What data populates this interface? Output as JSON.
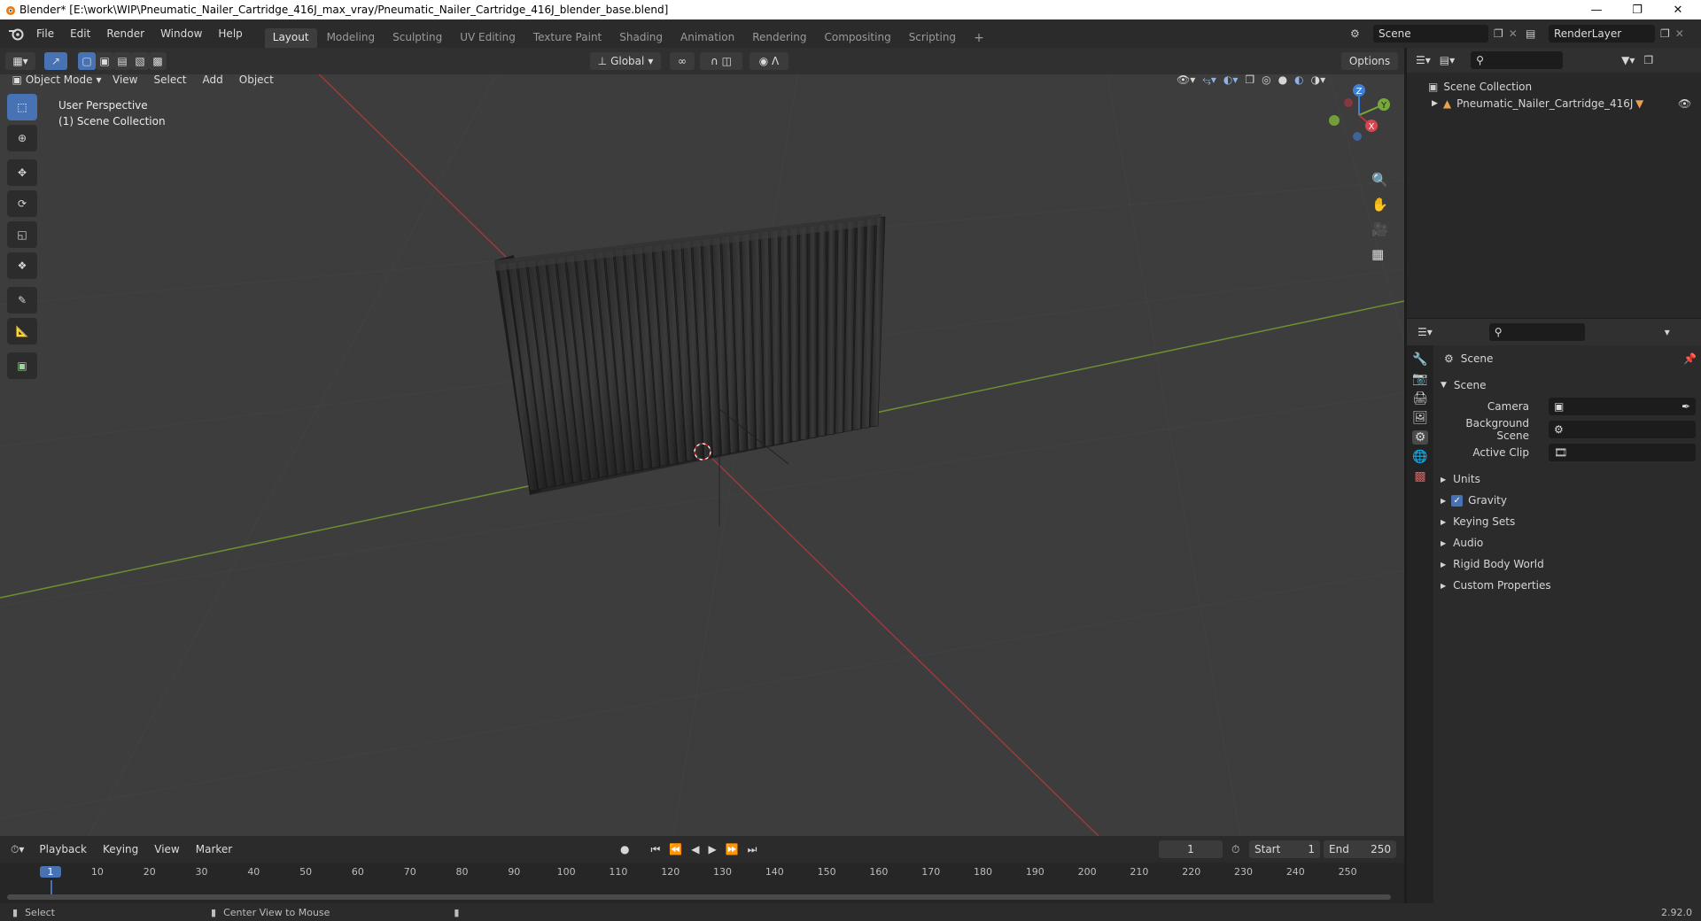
{
  "window": {
    "title": "Blender* [E:\\work\\WIP\\Pneumatic_Nailer_Cartridge_416J_max_vray/Pneumatic_Nailer_Cartridge_416J_blender_base.blend]"
  },
  "menu": [
    "File",
    "Edit",
    "Render",
    "Window",
    "Help"
  ],
  "workspaces": [
    "Layout",
    "Modeling",
    "Sculpting",
    "UV Editing",
    "Texture Paint",
    "Shading",
    "Animation",
    "Rendering",
    "Compositing",
    "Scripting"
  ],
  "active_workspace": "Layout",
  "scene_field": "Scene",
  "renderlayer_field": "RenderLayer",
  "viewport_header": {
    "transform_orientation": "Global",
    "options_label": "Options",
    "mode": "Object Mode",
    "menus": [
      "View",
      "Select",
      "Add",
      "Object"
    ]
  },
  "viewport": {
    "perspective_label": "User Perspective",
    "collection_label": "(1) Scene Collection",
    "gizmo_axes": {
      "x": "X",
      "y": "Y",
      "z": "Z"
    }
  },
  "outliner": {
    "root": "Scene Collection",
    "items": [
      {
        "label": "Pneumatic_Nailer_Cartridge_416J"
      }
    ]
  },
  "properties": {
    "breadcrumb": "Scene",
    "panel_title": "Scene",
    "fields": [
      {
        "label": "Camera",
        "value": ""
      },
      {
        "label": "Background Scene",
        "value": ""
      },
      {
        "label": "Active Clip",
        "value": ""
      }
    ],
    "sections": [
      {
        "label": "Units",
        "checkbox": false
      },
      {
        "label": "Gravity",
        "checkbox": true
      },
      {
        "label": "Keying Sets",
        "checkbox": false
      },
      {
        "label": "Audio",
        "checkbox": false
      },
      {
        "label": "Rigid Body World",
        "checkbox": false
      },
      {
        "label": "Custom Properties",
        "checkbox": false
      }
    ]
  },
  "timeline": {
    "menus": [
      "Playback",
      "Keying",
      "View",
      "Marker"
    ],
    "current_frame": "1",
    "start_label": "Start",
    "start_value": "1",
    "end_label": "End",
    "end_value": "250",
    "ruler": [
      "1",
      "10",
      "20",
      "30",
      "40",
      "50",
      "60",
      "70",
      "80",
      "90",
      "100",
      "110",
      "120",
      "130",
      "140",
      "150",
      "160",
      "170",
      "180",
      "190",
      "200",
      "210",
      "220",
      "230",
      "240",
      "250"
    ]
  },
  "statusbar": {
    "left_action": "Select",
    "middle_action": "Center View to Mouse",
    "version": "2.92.0"
  },
  "colors": {
    "accent": "#4772b3",
    "x_axis": "#b5353d",
    "y_axis": "#78a83a",
    "z_axis": "#3f7fd6",
    "viewport_bg": "#3d3d3d"
  }
}
